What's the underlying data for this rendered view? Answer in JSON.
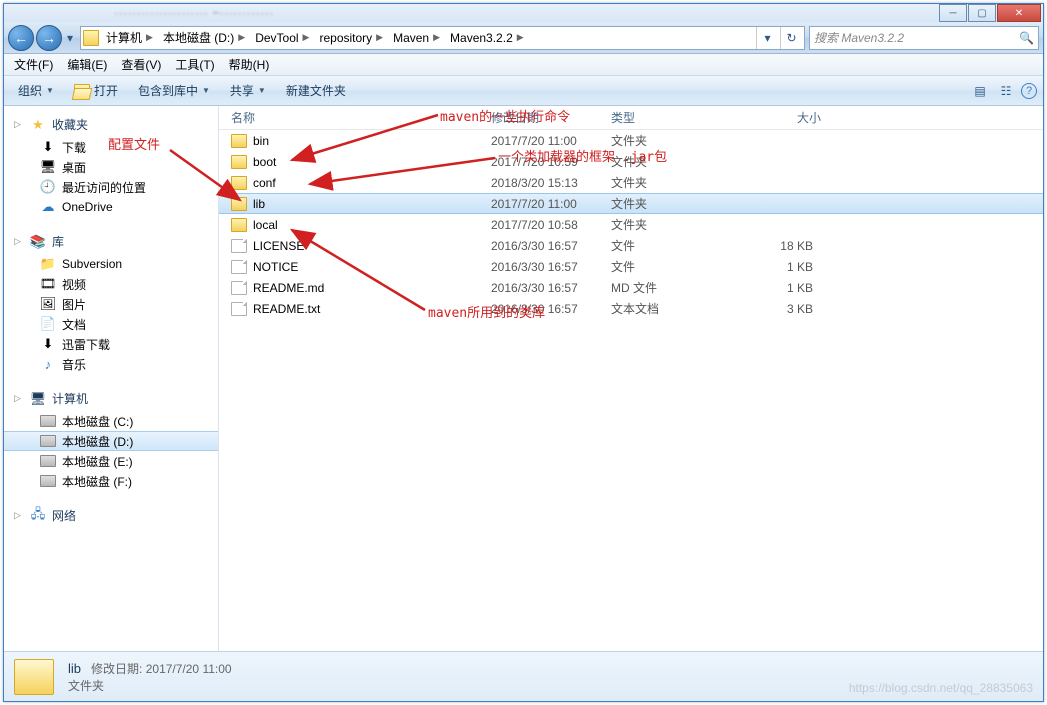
{
  "titlebar": {
    "blur": "····················· ~············"
  },
  "win": {
    "min": "─",
    "max": "▢",
    "close": "✕"
  },
  "nav": {
    "back": "←",
    "fwd": "→",
    "refresh": "↻",
    "drop": "▾"
  },
  "breadcrumbs": [
    "计算机",
    "本地磁盘 (D:)",
    "DevTool",
    "repository",
    "Maven",
    "Maven3.2.2"
  ],
  "search": {
    "placeholder": "搜索 Maven3.2.2",
    "icon": "🔍"
  },
  "menubar": [
    "文件(F)",
    "编辑(E)",
    "查看(V)",
    "工具(T)",
    "帮助(H)"
  ],
  "toolbar": {
    "organize": "组织",
    "open": "打开",
    "include": "包含到库中",
    "share": "共享",
    "newfolder": "新建文件夹",
    "view_icon": "▤",
    "list_icon": "☷",
    "help_icon": "?"
  },
  "sidebar": {
    "fav": {
      "hdr": "收藏夹",
      "items": [
        "下载",
        "桌面",
        "最近访问的位置",
        "OneDrive"
      ]
    },
    "lib": {
      "hdr": "库",
      "items": [
        "Subversion",
        "视频",
        "图片",
        "文档",
        "迅雷下载",
        "音乐"
      ]
    },
    "comp": {
      "hdr": "计算机",
      "items": [
        "本地磁盘 (C:)",
        "本地磁盘 (D:)",
        "本地磁盘 (E:)",
        "本地磁盘 (F:)"
      ]
    },
    "net": {
      "hdr": "网络"
    }
  },
  "columns": {
    "name": "名称",
    "date": "修改日期",
    "type": "类型",
    "size": "大小"
  },
  "rows": [
    {
      "name": "bin",
      "date": "2017/7/20 11:00",
      "type": "文件夹",
      "size": "",
      "folder": true
    },
    {
      "name": "boot",
      "date": "2017/7/20 10:59",
      "type": "文件夹",
      "size": "",
      "folder": true
    },
    {
      "name": "conf",
      "date": "2018/3/20 15:13",
      "type": "文件夹",
      "size": "",
      "folder": true
    },
    {
      "name": "lib",
      "date": "2017/7/20 11:00",
      "type": "文件夹",
      "size": "",
      "folder": true,
      "selected": true
    },
    {
      "name": "local",
      "date": "2017/7/20 10:58",
      "type": "文件夹",
      "size": "",
      "folder": true
    },
    {
      "name": "LICENSE",
      "date": "2016/3/30 16:57",
      "type": "文件",
      "size": "18 KB",
      "folder": false
    },
    {
      "name": "NOTICE",
      "date": "2016/3/30 16:57",
      "type": "文件",
      "size": "1 KB",
      "folder": false
    },
    {
      "name": "README.md",
      "date": "2016/3/30 16:57",
      "type": "MD 文件",
      "size": "1 KB",
      "folder": false
    },
    {
      "name": "README.txt",
      "date": "2016/3/30 16:57",
      "type": "文本文档",
      "size": "3 KB",
      "folder": false
    }
  ],
  "details": {
    "name": "lib",
    "type": "文件夹",
    "meta_lbl": "修改日期:",
    "meta_val": "2017/7/20 11:00"
  },
  "annotations": {
    "a1": "配置文件",
    "a2": "maven的一些执行命令",
    "a3": "一个类加载器的框架 .jar包",
    "a4": "maven所用到的类库"
  },
  "watermark": "https://blog.csdn.net/qq_28835063"
}
